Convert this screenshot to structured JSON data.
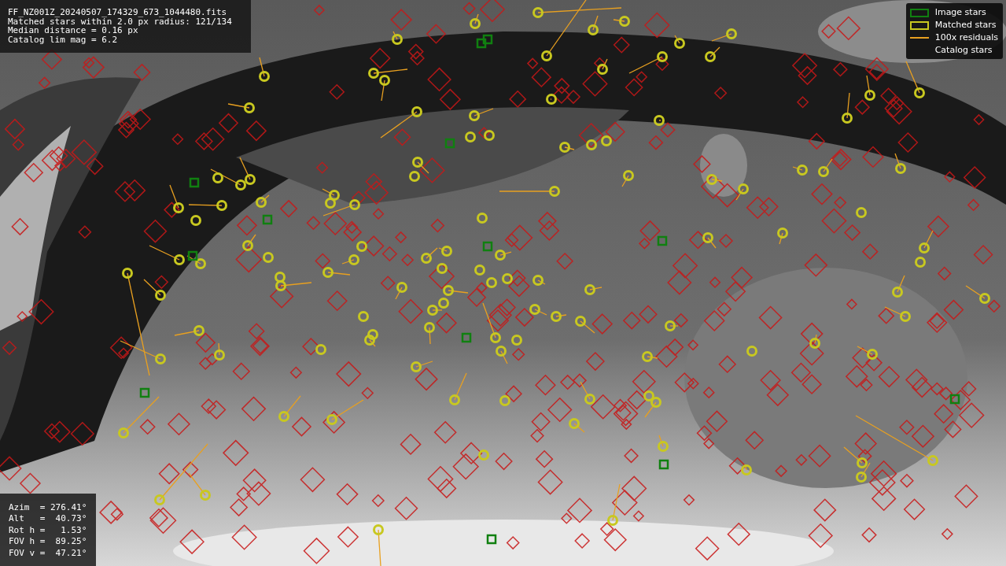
{
  "info_panel": {
    "lines": [
      "FF_NZ001Z_20240507_174329_673_1044480.fits",
      "Matched stars within 2.0 px radius: 121/134",
      "Median distance = 0.16 px",
      "Catalog lim mag = 6.2"
    ]
  },
  "legend": {
    "items": [
      {
        "label": "Image stars",
        "kind": "box",
        "color": "#108010"
      },
      {
        "label": "Matched stars",
        "kind": "box",
        "color": "#c8c820"
      },
      {
        "label": "100x residuals",
        "kind": "line",
        "color": "#e8a020"
      },
      {
        "label": "Catalog stars",
        "kind": "none"
      }
    ]
  },
  "pointing_panel": {
    "lines": [
      "Azim  = 276.41°",
      "Alt   =  40.73°",
      "Rot h =   1.53°",
      "FOV h =  89.25°",
      "FOV v =  47.21°"
    ]
  }
}
